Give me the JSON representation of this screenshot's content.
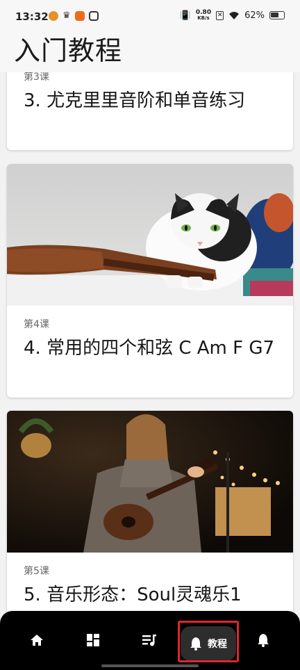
{
  "status_bar": {
    "time": "13:32",
    "net_speed_value": "0.80",
    "net_speed_unit": "KB/s",
    "battery": "62%"
  },
  "header": {
    "title": "入门教程"
  },
  "lessons": [
    {
      "label": "第3课",
      "title": "3. 尤克里里音阶和单音练习"
    },
    {
      "label": "第4课",
      "title": "4. 常用的四个和弦 C Am F G7"
    },
    {
      "label": "第5课",
      "title": "5. 音乐形态：Soul灵魂乐1"
    }
  ],
  "bottom_nav": {
    "items": [
      {
        "icon": "home-icon"
      },
      {
        "icon": "dashboard-icon"
      },
      {
        "icon": "playlist-icon"
      },
      {
        "icon": "bell-icon",
        "label": "教程",
        "active": true
      },
      {
        "icon": "bell-icon"
      }
    ]
  },
  "colors": {
    "highlight": "#e0262f",
    "nav_bg": "#000000",
    "active_pill": "#2d2d2d"
  }
}
